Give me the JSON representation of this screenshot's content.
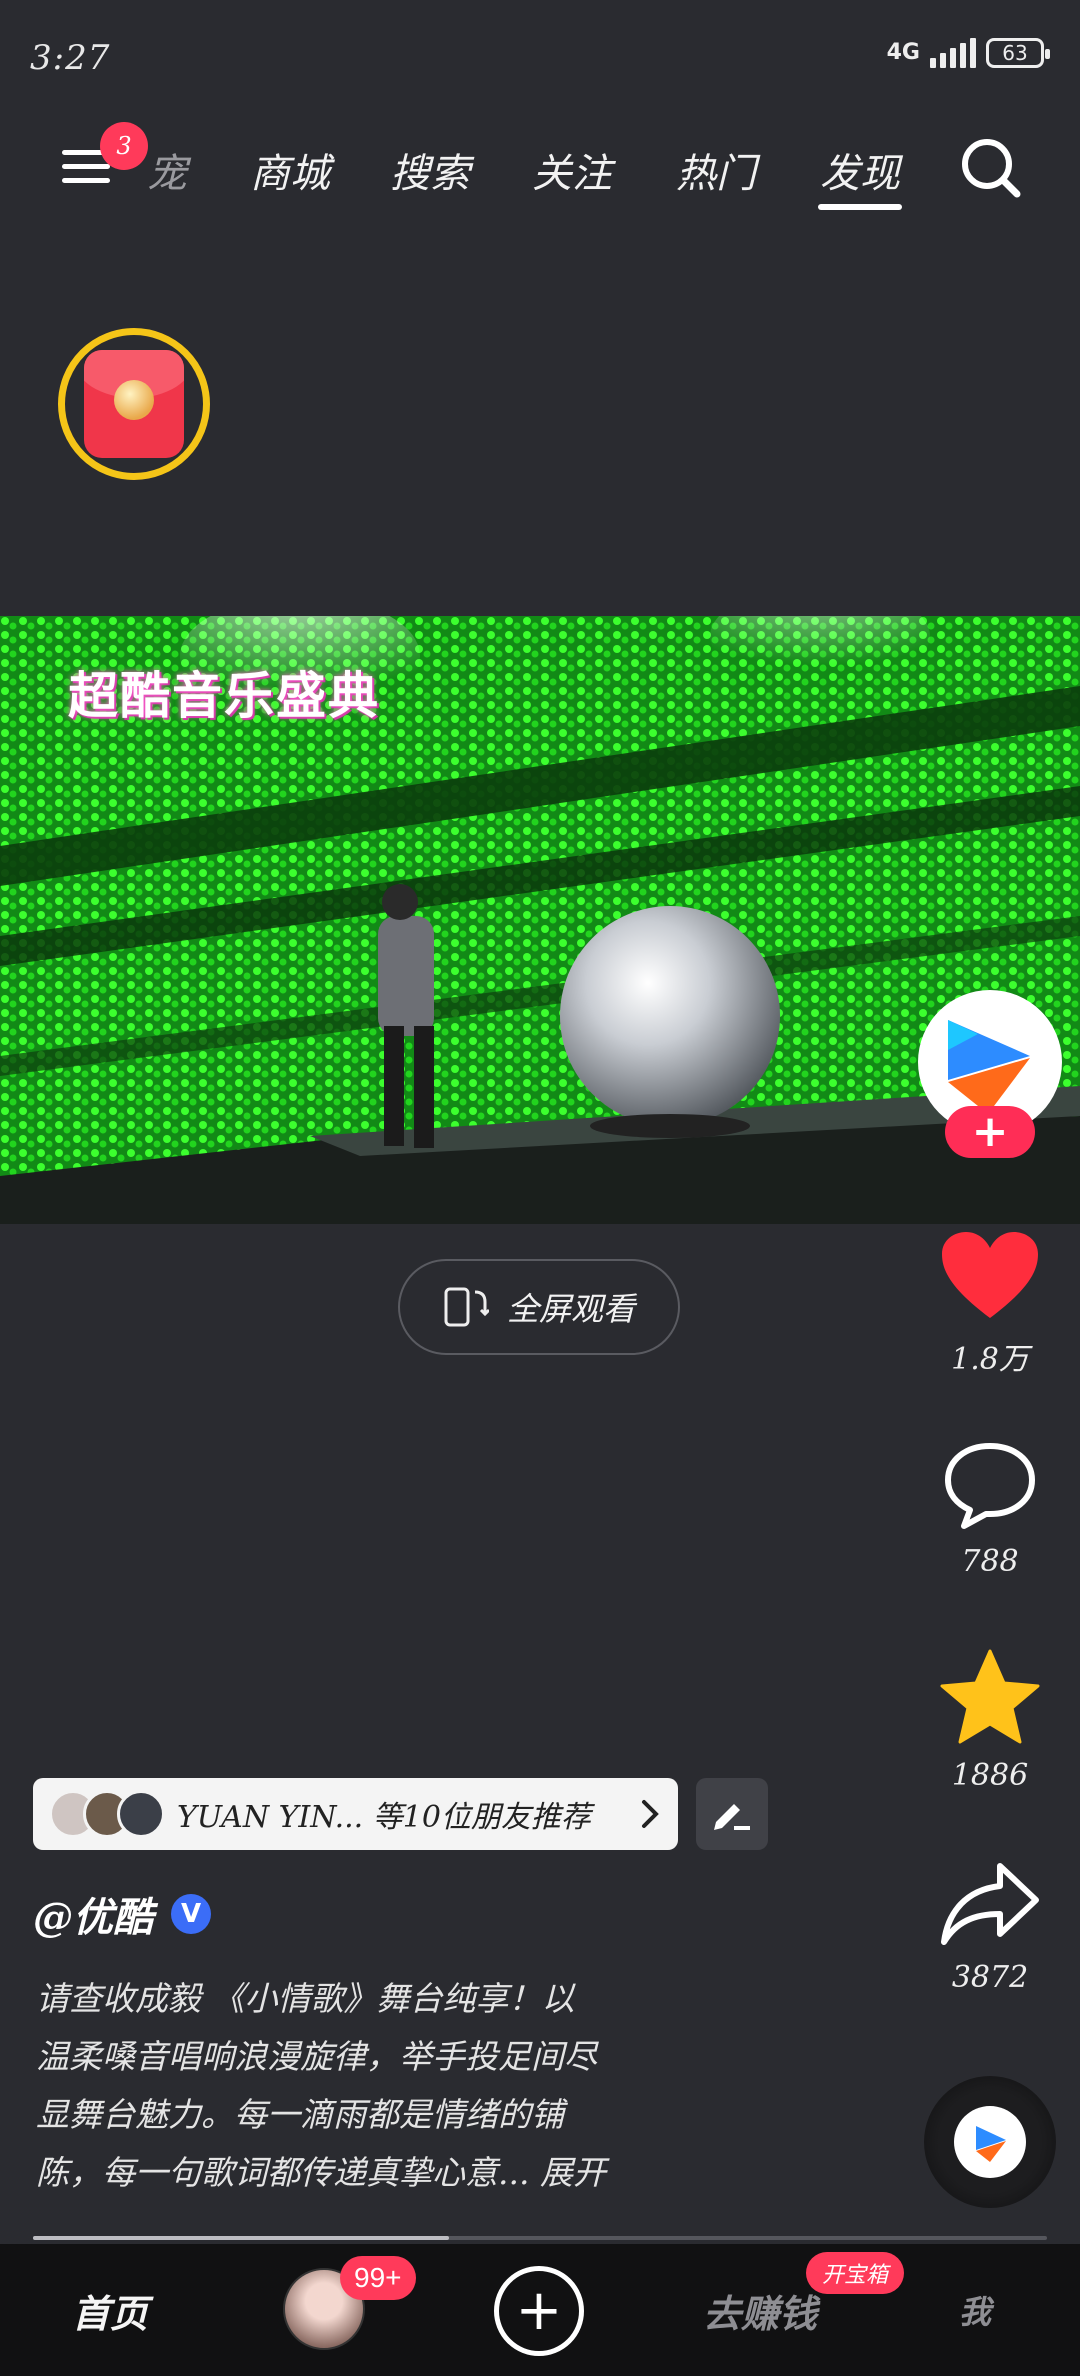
{
  "status_bar": {
    "time": "3:27",
    "network": "4G",
    "battery": "63"
  },
  "top_nav": {
    "menu_badge": "3",
    "tabs": [
      {
        "label": "宠"
      },
      {
        "label": "商城"
      },
      {
        "label": "搜索"
      },
      {
        "label": "关注"
      },
      {
        "label": "热门"
      },
      {
        "label": "发现"
      }
    ],
    "active_tab": "发现"
  },
  "video": {
    "overlay_title": "超酷音乐盛典"
  },
  "fullscreen": {
    "label": "全屏观看"
  },
  "actions": {
    "like_count": "1.8万",
    "comment_count": "788",
    "favorite_count": "1886",
    "share_count": "3872"
  },
  "recommend": {
    "text": "YUAN YIN... 等10位朋友推荐"
  },
  "author": {
    "name": "@优酷",
    "verified_mark": "V"
  },
  "description": {
    "lines": [
      "请查收成毅 《小情歌》舞台纯享！以",
      "温柔嗓音唱响浪漫旋律，举手投足间尽",
      "显舞台魅力。每一滴雨都是情绪的铺",
      "陈，每一句歌词都传递真挚心意... 展开"
    ]
  },
  "playback": {
    "progress": 0.41
  },
  "bottom_nav": {
    "home": "首页",
    "avatar_badge": "99+",
    "earn": "去赚钱",
    "earn_badge": "开宝箱",
    "me": "我"
  },
  "colors": {
    "accent": "#ff2d56",
    "like": "#ff2d3d",
    "favorite": "#ffc21a",
    "verified": "#3b6df7",
    "background": "#2a2b30"
  }
}
